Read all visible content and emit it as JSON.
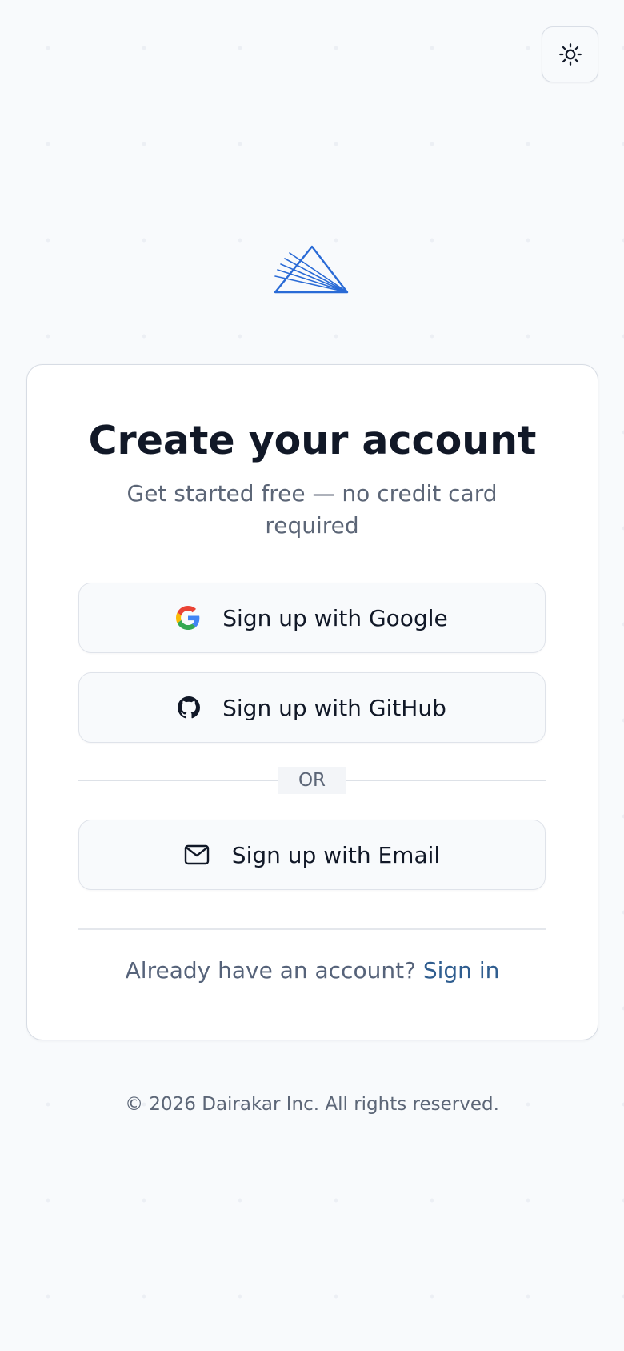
{
  "header": {
    "theme_toggle_icon": "sun-icon"
  },
  "brand": {
    "logo_icon": "triangle-rays-logo",
    "accent_color": "#2a6bd6"
  },
  "card": {
    "title": "Create your account",
    "subtitle": "Get started free — no credit card required",
    "buttons": [
      {
        "label": "Sign up with Google",
        "icon": "google-icon"
      },
      {
        "label": "Sign up with GitHub",
        "icon": "github-icon"
      },
      {
        "label": "Sign up with Email",
        "icon": "mail-icon"
      }
    ],
    "divider_label": "OR",
    "signin_prompt": "Already have an account?",
    "signin_link": "Sign in",
    "link_color": "#2f5d8f"
  },
  "footer": {
    "copyright": "© 2026 Dairakar Inc. All rights reserved."
  }
}
